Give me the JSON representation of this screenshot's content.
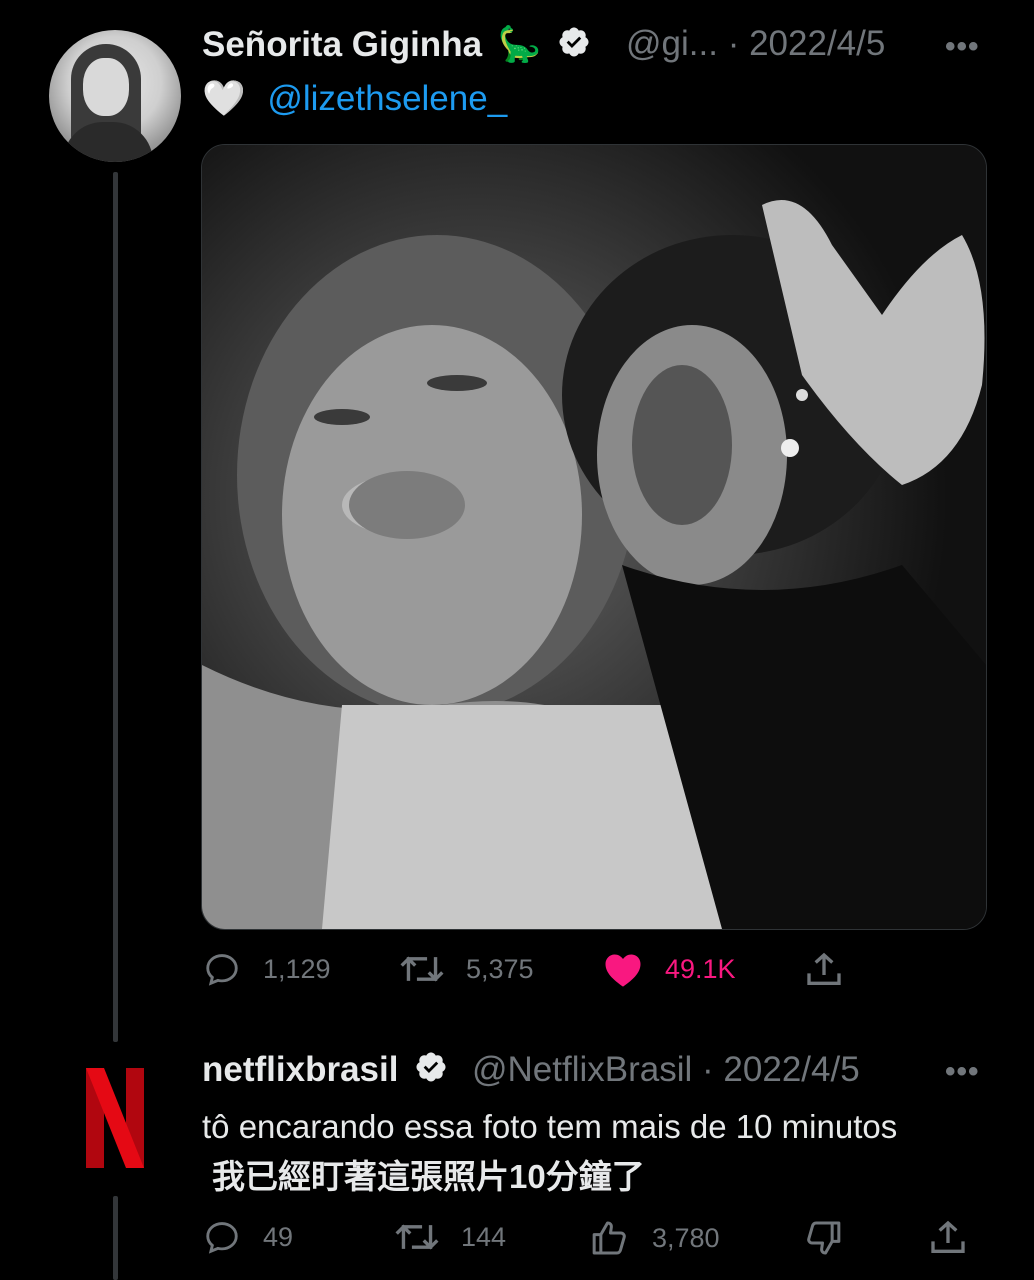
{
  "tweet": {
    "display_name": "Señorita Giginha",
    "name_emoji": "🦕",
    "handle": "@gi...",
    "separator": "·",
    "date": "2022/4/5",
    "more_label": "•••",
    "reply_heart": "🤍",
    "reply_mention": "@lizethselene_",
    "stats": {
      "replies": "1,129",
      "retweets": "5,375",
      "likes": "49.1K"
    },
    "accent_like_color": "#f91880"
  },
  "reply": {
    "display_name": "netflixbrasil",
    "handle": "@NetflixBrasil",
    "separator": "·",
    "date": "2022/4/5",
    "more_label": "•••",
    "text": "tô encarando essa foto tem mais de 10 minutos",
    "translation": "我已經盯著這張照片10分鐘了",
    "stats": {
      "replies": "49",
      "retweets": "144",
      "likes": "3,780"
    },
    "brand_color": "#e50914"
  },
  "colors": {
    "background": "#000000",
    "text_primary": "#e7e9ea",
    "text_secondary": "#71767b",
    "link": "#1d9bf0"
  }
}
